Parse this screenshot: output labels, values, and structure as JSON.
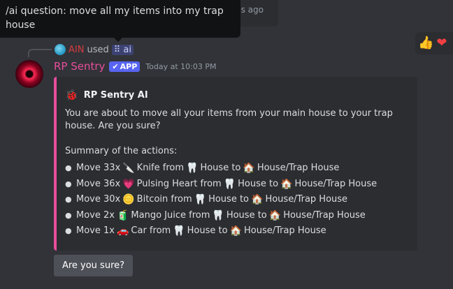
{
  "previous_message": {
    "timestamp_fragment": "ds ago"
  },
  "tooltip": {
    "text": "/ai question: move all my items into my trap house"
  },
  "reactions": [
    {
      "icon": "thumbs-up-icon",
      "glyph": "👍"
    },
    {
      "icon": "heart-icon",
      "glyph": "❤"
    }
  ],
  "reply": {
    "username": "AIN",
    "used_text": "used",
    "command_glyph": "⠿",
    "command": "ai"
  },
  "message": {
    "bot_name": "RP Sentry",
    "badge_check": "✔",
    "badge": "APP",
    "timestamp": "Today at 10:03 PM"
  },
  "embed": {
    "accent_color": "#e84d9b",
    "author_icon": "🐞",
    "author_name": "RP Sentry AI",
    "description": "You are about to move all your items from your main house to your trap house. Are you sure?",
    "summary_title": "Summary of the actions:",
    "actions": [
      {
        "bullet": "●",
        "prefix": "Move 33x",
        "item_emoji": "🔪",
        "item": "Knife from",
        "from_emoji": "🦷",
        "from": "House to",
        "to_emoji": "🏠",
        "to": "House/Trap House"
      },
      {
        "bullet": "●",
        "prefix": "Move 36x",
        "item_emoji": "💗",
        "item": "Pulsing Heart from",
        "from_emoji": "🦷",
        "from": "House to",
        "to_emoji": "🏠",
        "to": "House/Trap House"
      },
      {
        "bullet": "●",
        "prefix": "Move 30x",
        "item_emoji": "🪙",
        "item": "Bitcoin from",
        "from_emoji": "🦷",
        "from": "House to",
        "to_emoji": "🏠",
        "to": "House/Trap House"
      },
      {
        "bullet": "●",
        "prefix": "Move 2x",
        "item_emoji": "🧃",
        "item": "Mango Juice from",
        "from_emoji": "🦷",
        "from": "House to",
        "to_emoji": "🏠",
        "to": "House/Trap House"
      },
      {
        "bullet": "●",
        "prefix": "Move 1x",
        "item_emoji": "🚗",
        "item": "Car from",
        "from_emoji": "🦷",
        "from": "House to",
        "to_emoji": "🏠",
        "to": "House/Trap House"
      }
    ]
  },
  "confirm_button": {
    "label": "Are you sure?"
  }
}
